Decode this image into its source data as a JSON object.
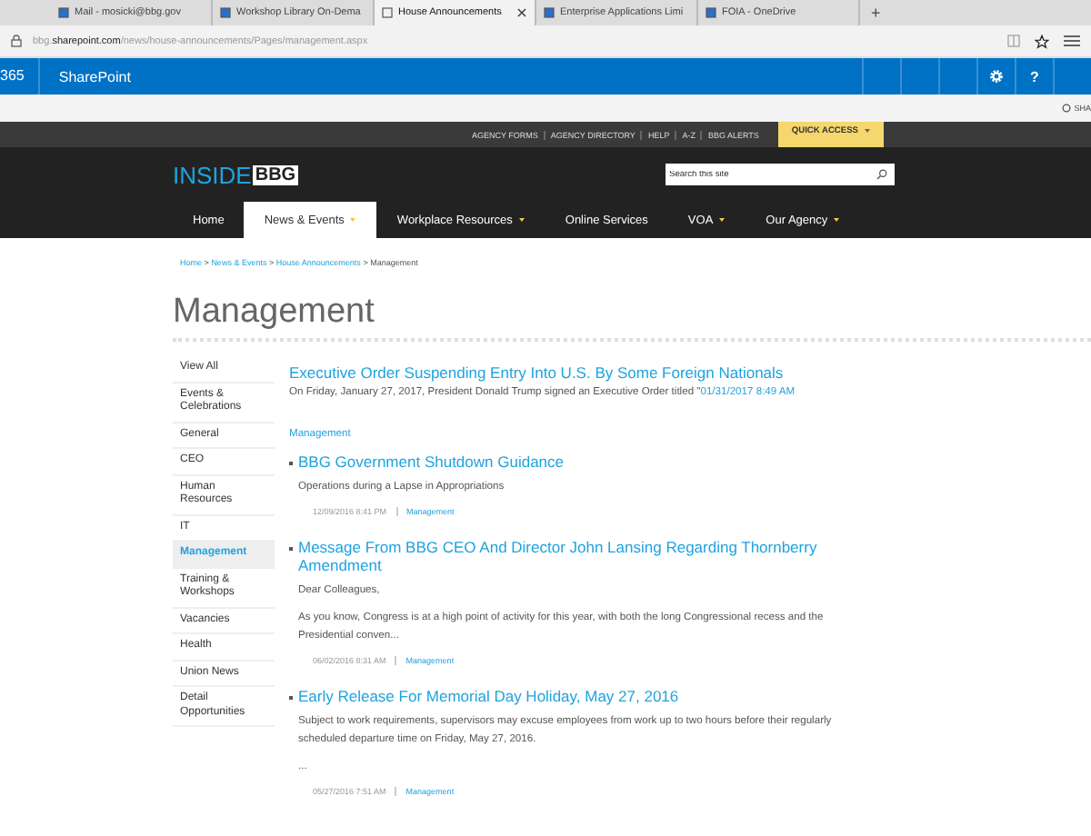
{
  "browser_tabs": [
    {
      "title": "Mail - mosicki@bbg.gov",
      "selected": false
    },
    {
      "title": "Workshop Library On-Dema",
      "selected": false
    },
    {
      "title": "House Announcements",
      "selected": true
    },
    {
      "title": "Enterprise Applications Limi",
      "selected": false
    },
    {
      "title": "FOIA - OneDrive",
      "selected": false
    }
  ],
  "new_tab": "+",
  "address": "bbg.**sharepoint.com**/news/house-announcements/Pages/management.aspx",
  "suite_bar": {
    "app_number": "365",
    "app_name": "SharePoint",
    "help": "?"
  },
  "share_label": "SHA",
  "utility_links": [
    "AGENCY FORMS",
    "AGENCY DIRECTORY",
    "HELP",
    "A-Z",
    "BBG ALERTS"
  ],
  "quick_access": "QUICK ACCESS",
  "logo": {
    "prefix": "INSIDE",
    "mark": "BBG"
  },
  "search": {
    "placeholder": "Search this site"
  },
  "nav": [
    {
      "label": "Home",
      "selected": false,
      "has_menu": false
    },
    {
      "label": "News & Events",
      "selected": true,
      "has_menu": true
    },
    {
      "label": "Workplace Resources",
      "selected": false,
      "has_menu": true
    },
    {
      "label": "Online Services",
      "selected": false,
      "has_menu": false
    },
    {
      "label": "VOA",
      "selected": false,
      "has_menu": true
    },
    {
      "label": "Our Agency",
      "selected": false,
      "has_menu": true
    }
  ],
  "breadcrumb": {
    "links": [
      "Home",
      "News & Events",
      "House Announcements"
    ],
    "separator": ">",
    "current": "Management"
  },
  "page_title": "Management",
  "sidebar": {
    "items": [
      {
        "label": "View All",
        "selected": false
      },
      {
        "label": "Events & Celebrations",
        "selected": false
      },
      {
        "label": "General",
        "selected": false
      },
      {
        "label": "CEO",
        "selected": false
      },
      {
        "label": "Human Resources",
        "selected": false
      },
      {
        "label": "IT",
        "selected": false
      },
      {
        "label": "Management",
        "selected": true
      },
      {
        "label": "Training & Workshops",
        "selected": false
      },
      {
        "label": "Vacancies",
        "selected": false
      },
      {
        "label": "Health",
        "selected": false
      },
      {
        "label": "Union News",
        "selected": false
      },
      {
        "label": "Detail Opportunities",
        "selected": false
      }
    ]
  },
  "featured": {
    "title": "Executive Order Suspending Entry Into U.S. By Some Foreign Nationals",
    "text": "On Friday, January 27, 2017, President Donald Trump signed an Executive Order titled \"",
    "date": "01/31/2017 8:49 AM"
  },
  "section_label": "Management",
  "posts": [
    {
      "title": "BBG Government Shutdown Guidance",
      "summary": [
        "Operations during a Lapse in Appropriations"
      ],
      "date": "12/09/2016 8:41 PM",
      "category": "Management"
    },
    {
      "title": "Message From BBG CEO And Director John Lansing Regarding Thornberry Amendment",
      "summary": [
        "Dear Colleagues,",
        "As you know, Congress is at a high point of activity for this year, with both the long Congressional recess and the Presidential conven..."
      ],
      "date": "06/02/2016 8:31 AM",
      "category": "Management"
    },
    {
      "title": "Early Release For Memorial Day Holiday, May 27, 2016",
      "summary": [
        "Subject to work requirements, supervisors may excuse employees from work up to two hours before their regularly scheduled departure time on Friday, May 27, 2016.",
        "..."
      ],
      "date": "05/27/2016 7:51 AM",
      "category": "Management"
    }
  ]
}
